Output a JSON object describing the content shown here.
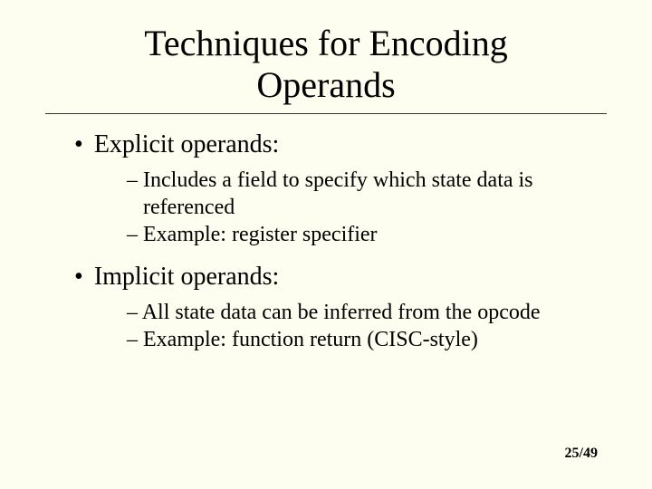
{
  "title_line1": "Techniques for Encoding",
  "title_line2": "Operands",
  "bullets": [
    {
      "text": "Explicit operands:",
      "subs": [
        "Includes a field to specify which state data is referenced",
        "Example: register specifier"
      ]
    },
    {
      "text": "Implicit operands:",
      "subs": [
        "All state data can be inferred from the opcode",
        "Example: function return (CISC-style)"
      ]
    }
  ],
  "page_number": "25/49"
}
